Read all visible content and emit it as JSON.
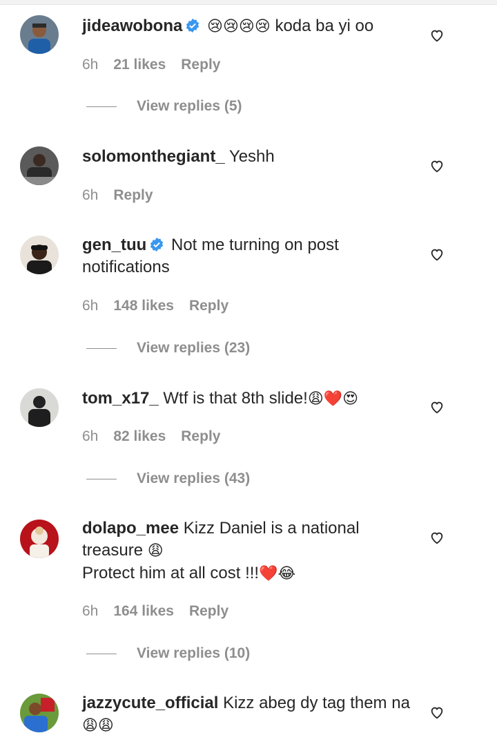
{
  "comments": [
    {
      "username": "jideawobona",
      "verified": true,
      "text": "koda ba yi oo",
      "emojis": "😢😢😢😢",
      "emojis_after": "",
      "time": "6h",
      "likes": "21 likes",
      "reply": "Reply",
      "view_replies": "View replies (5)"
    },
    {
      "username": "solomonthegiant_",
      "verified": false,
      "text": "Yeshh",
      "time": "6h",
      "reply": "Reply"
    },
    {
      "username": "gen_tuu",
      "verified": true,
      "text": "Not me turning on post notifications",
      "time": "6h",
      "likes": "148 likes",
      "reply": "Reply",
      "view_replies": "View replies (23)"
    },
    {
      "username": "tom_x17_",
      "verified": false,
      "text": "Wtf is that 8th slide!",
      "emojis_after": "😩❤️😍",
      "time": "6h",
      "likes": "82 likes",
      "reply": "Reply",
      "view_replies": "View replies (43)"
    },
    {
      "username": "dolapo_mee",
      "verified": false,
      "text": "Kizz Daniel is a national treasure",
      "emoji1": "😩",
      "text2": "Protect him at all cost !!!",
      "emoji2": "❤️😂",
      "time": "6h",
      "likes": "164 likes",
      "reply": "Reply",
      "view_replies": "View replies (10)"
    },
    {
      "username": "jazzycute_official",
      "verified": false,
      "text": "Kizz abeg dy tag them na",
      "emojis_after": "😩😩"
    }
  ],
  "colors": {
    "text": "#262626",
    "secondary": "#8e8e8e",
    "verified": "#3897f0"
  },
  "icons": {
    "like": "heart-outline-icon",
    "verified": "verified-badge-icon"
  }
}
